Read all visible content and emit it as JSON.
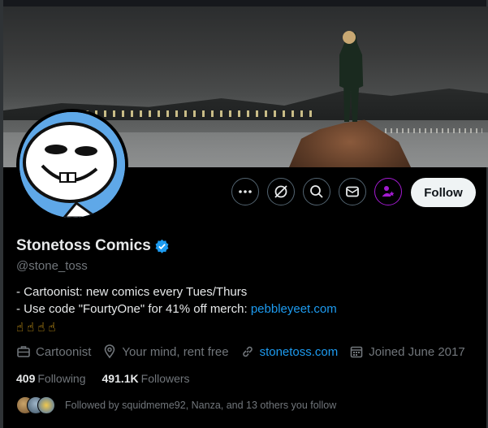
{
  "profile": {
    "name": "Stonetoss Comics",
    "handle": "@stone_toss",
    "bio_line1": "- Cartoonist: new comics every Tues/Thurs",
    "bio_line2_prefix": "- Use code \"FourtyOne\" for 41% off merch: ",
    "bio_link": "pebbleyeet.com",
    "emojis": [
      "☝",
      "☝",
      "☝",
      "☝"
    ],
    "verified": true
  },
  "meta": {
    "profession": "Cartoonist",
    "location": "Your mind, rent free",
    "website": "stonetoss.com",
    "joined": "Joined June 2017"
  },
  "stats": {
    "following_count": "409",
    "following_label": "Following",
    "followers_count": "491.1K",
    "followers_label": "Followers"
  },
  "followed_by": "Followed by squidmeme92, Nanza, and 13 others you follow",
  "actions": {
    "follow_label": "Follow",
    "icons": [
      "more-icon",
      "grok-icon",
      "search-icon",
      "message-icon",
      "subscribe-icon"
    ]
  },
  "colors": {
    "accent": "#1d9bf0",
    "subscribe": "#a31bd1",
    "verified": "#1d9bf0"
  }
}
